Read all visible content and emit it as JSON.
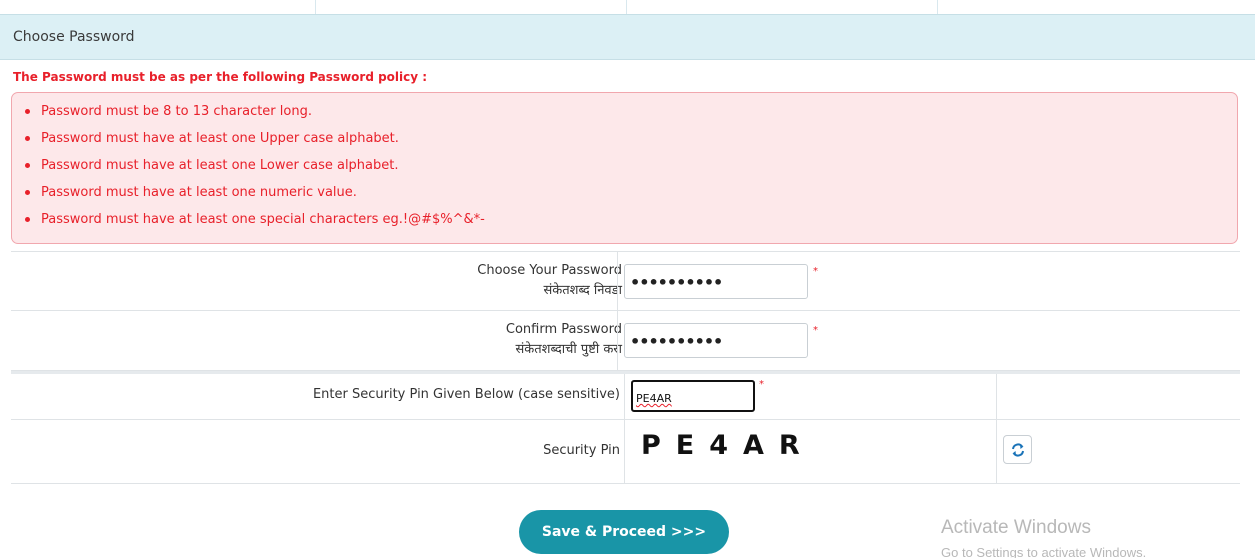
{
  "section": {
    "title": "Choose Password"
  },
  "policy": {
    "title": "The Password must be as per the following Password policy :",
    "items": [
      "Password must be 8 to 13 character long.",
      "Password must have at least one Upper case alphabet.",
      "Password must have at least one Lower case alphabet.",
      "Password must have at least one numeric value.",
      "Password must have at least one special characters eg.!@#$%^&*-"
    ]
  },
  "form": {
    "choose_password": {
      "label_en": "Choose Your Password",
      "label_mr": "संकेतशब्द निवडा",
      "value": "••••••••••"
    },
    "confirm_password": {
      "label_en": "Confirm Password",
      "label_mr": "संकेतशब्दाची पुष्टी करा",
      "value": "••••••••••"
    },
    "required_mark": "*",
    "security_pin_input": {
      "label": "Enter Security Pin Given Below (case sensitive)",
      "value": "PE4AR"
    },
    "security_pin": {
      "label": "Security Pin",
      "captcha_text": "PE4AR"
    }
  },
  "actions": {
    "save_label": "Save & Proceed >>>"
  },
  "watermark": {
    "line1": "Activate Windows",
    "line2": "Go to Settings to activate Windows."
  },
  "colors": {
    "accent": "#1995a7",
    "error": "#e8202a",
    "header_bg": "#dcf0f5",
    "policy_bg": "#fde8ea"
  },
  "icons": {
    "refresh": "refresh-icon"
  }
}
